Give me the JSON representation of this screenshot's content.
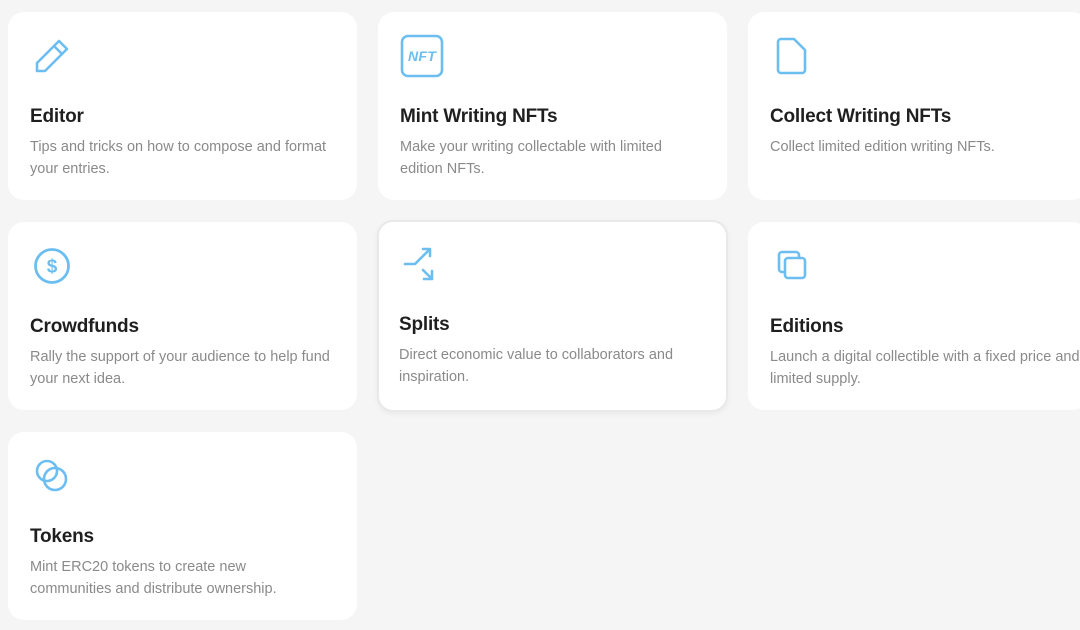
{
  "accent_color": "#6cbef0",
  "cards": [
    {
      "icon": "pencil-icon",
      "title": "Editor",
      "description": "Tips and tricks on how to compose and format your entries."
    },
    {
      "icon": "nft-icon",
      "icon_text": "NFT",
      "title": "Mint Writing NFTs",
      "description": "Make your writing collectable with limited edition NFTs."
    },
    {
      "icon": "document-icon",
      "title": "Collect Writing NFTs",
      "description": "Collect limited edition writing NFTs."
    },
    {
      "icon": "dollar-coin-icon",
      "title": "Crowdfunds",
      "description": "Rally the support of your audience to help fund your next idea."
    },
    {
      "icon": "split-arrows-icon",
      "title": "Splits",
      "description": "Direct economic value to collaborators and inspiration."
    },
    {
      "icon": "copy-squares-icon",
      "title": "Editions",
      "description": "Launch a digital collectible with a fixed price and limited supply."
    },
    {
      "icon": "overlapping-circles-icon",
      "title": "Tokens",
      "description": "Mint ERC20 tokens to create new communities and distribute ownership."
    }
  ]
}
